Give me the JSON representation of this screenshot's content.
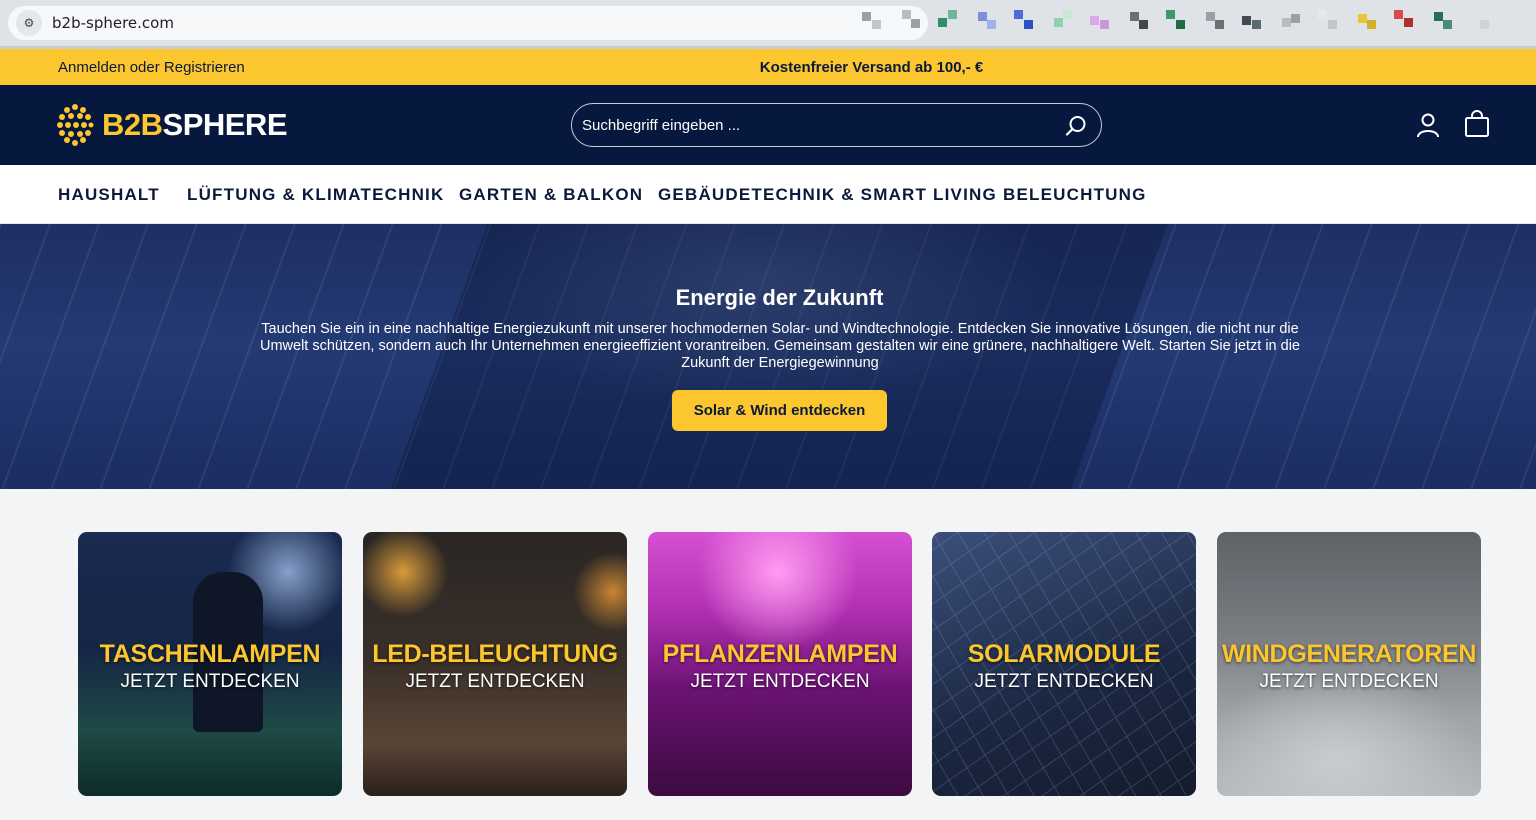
{
  "browser": {
    "url": "b2b-sphere.com"
  },
  "topbar": {
    "login_label": "Anmelden oder Registrieren",
    "shipping_text": "Kostenfreier Versand ab 100,- €",
    "background": "#fcc62e"
  },
  "header": {
    "logo_text_accent": "B2B",
    "logo_text_main": "SPHERE",
    "search_placeholder": "Suchbegriff eingeben ...",
    "background": "#07183f"
  },
  "nav": {
    "items": [
      {
        "label": "HAUSHALT"
      },
      {
        "label": "LÜFTUNG & KLIMATECHNIK"
      },
      {
        "label": "GARTEN & BALKON"
      },
      {
        "label": "GEBÄUDETECHNIK & SMART LIVING"
      },
      {
        "label": "BELEUCHTUNG"
      }
    ]
  },
  "hero": {
    "title": "Energie der Zukunft",
    "text": "Tauchen Sie ein in eine nachhaltige Energiezukunft mit unserer hochmodernen Solar- und Windtechnologie. Entdecken Sie innovative Lösungen, die nicht nur die Umwelt schützen, sondern auch Ihr Unternehmen energieeffizient vorantreiben. Gemeinsam gestalten wir eine grünere, nachhaltigere Welt. Starten Sie jetzt in die Zukunft der Energiegewinnung",
    "cta_label": "Solar & Wind entdecken"
  },
  "categories": [
    {
      "title": "TASCHENLAMPEN",
      "subtitle": "JETZT ENTDECKEN"
    },
    {
      "title": "LED-BELEUCHTUNG",
      "subtitle": "JETZT ENTDECKEN"
    },
    {
      "title": "PFLANZENLAMPEN",
      "subtitle": "JETZT ENTDECKEN"
    },
    {
      "title": "SOLARMODULE",
      "subtitle": "JETZT ENTDECKEN"
    },
    {
      "title": "WINDGENERATOREN",
      "subtitle": "JETZT ENTDECKEN"
    }
  ],
  "colors": {
    "accent": "#fcc62e",
    "navy": "#07183f"
  }
}
